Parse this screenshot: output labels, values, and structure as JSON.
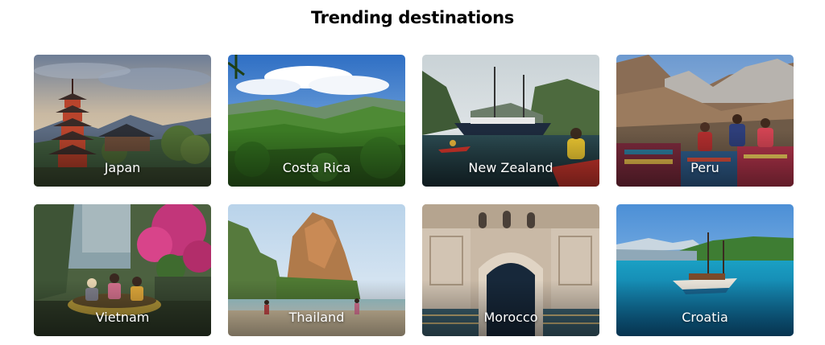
{
  "section": {
    "title": "Trending destinations"
  },
  "destinations": [
    {
      "name": "Japan",
      "image": "japan-pagoda-photo"
    },
    {
      "name": "Costa Rica",
      "image": "costa-rica-rainforest-photo"
    },
    {
      "name": "New Zealand",
      "image": "new-zealand-fjord-boat-photo"
    },
    {
      "name": "Peru",
      "image": "peru-andes-market-photo"
    },
    {
      "name": "Vietnam",
      "image": "vietnam-basket-boat-photo"
    },
    {
      "name": "Thailand",
      "image": "thailand-beach-cliff-photo"
    },
    {
      "name": "Morocco",
      "image": "morocco-mosaic-doorway-photo"
    },
    {
      "name": "Croatia",
      "image": "croatia-sailing-ship-photo"
    }
  ]
}
